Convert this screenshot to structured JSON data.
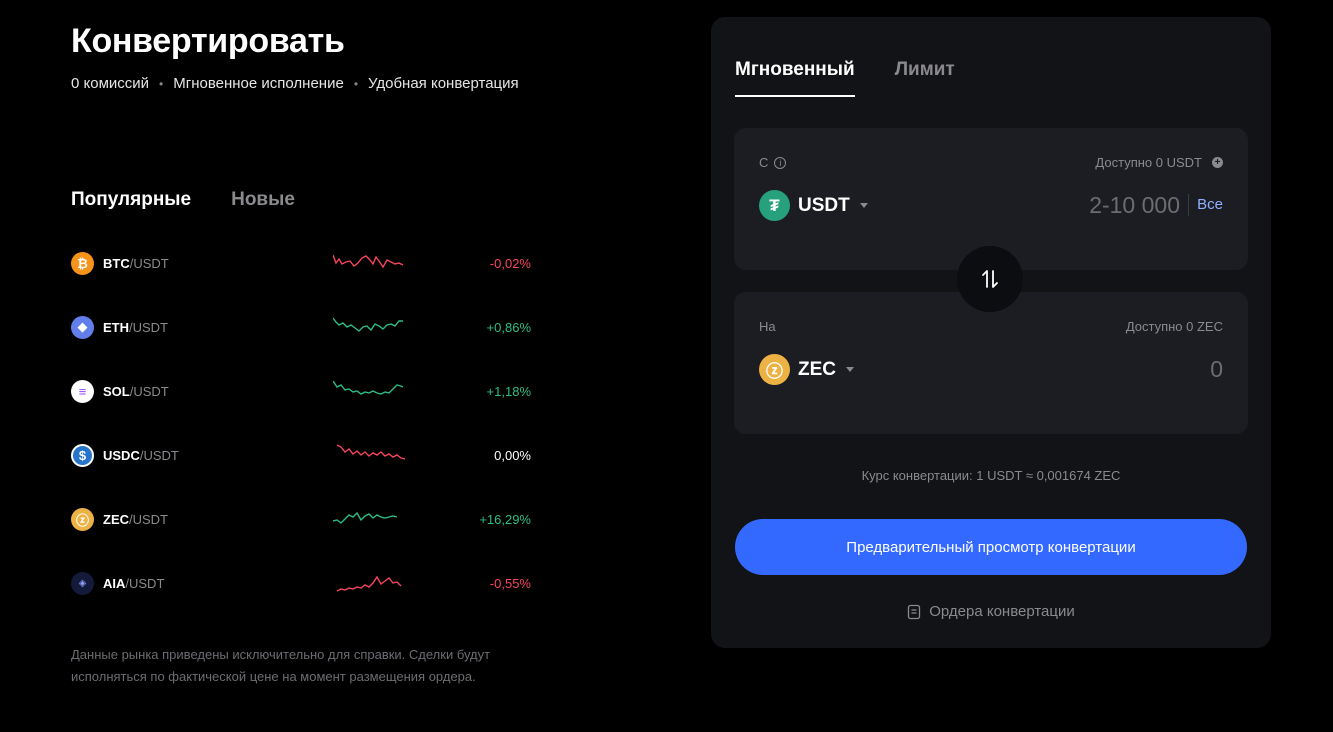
{
  "header": {
    "title": "Конвертировать",
    "features": [
      "0 комиссий",
      "Мгновенное исполнение",
      "Удобная конвертация"
    ]
  },
  "market": {
    "tabs": [
      "Популярные",
      "Новые"
    ],
    "pairs": [
      {
        "base": "BTC",
        "quote": "/USDT",
        "change": "-0,02%",
        "trend": "neg",
        "icon": "bitcoin-icon",
        "color": "#f7931a",
        "glyph": "₿"
      },
      {
        "base": "ETH",
        "quote": "/USDT",
        "change": "+0,86%",
        "trend": "pos",
        "icon": "ethereum-icon",
        "color": "#627eea",
        "glyph": "◆"
      },
      {
        "base": "SOL",
        "quote": "/USDT",
        "change": "+1,18%",
        "trend": "pos",
        "icon": "solana-icon",
        "color": "#ffffff",
        "glyph": "≡"
      },
      {
        "base": "USDC",
        "quote": "/USDT",
        "change": "0,00%",
        "trend": "neu",
        "icon": "usdc-icon",
        "color": "#2775ca",
        "glyph": "$"
      },
      {
        "base": "ZEC",
        "quote": "/USDT",
        "change": "+16,29%",
        "trend": "pos",
        "icon": "zcash-icon",
        "color": "#ecb244",
        "glyph": "ⓩ"
      },
      {
        "base": "AIA",
        "quote": "/USDT",
        "change": "-0,55%",
        "trend": "neg",
        "icon": "aia-icon",
        "color": "#141a3a",
        "glyph": "◈"
      }
    ],
    "disclaimer": "Данные рынка приведены исключительно для справки. Сделки будут исполняться по фактической цене на момент размещения ордера."
  },
  "converter": {
    "tabs": [
      "Мгновенный",
      "Лимит"
    ],
    "from": {
      "label": "С",
      "available": "Доступно 0 USDT",
      "coin": "USDT",
      "amount_placeholder": "2-10 000",
      "all_label": "Все"
    },
    "to": {
      "label": "На",
      "available": "Доступно 0 ZEC",
      "coin": "ZEC",
      "amount": "0"
    },
    "rate": "Курс конвертации: 1 USDT ≈ 0,001674 ZEC",
    "preview_label": "Предварительный просмотр конвертации",
    "orders_label": "Ордера конвертации"
  },
  "colors": {
    "accent": "#3369ff",
    "negative": "#f6465d",
    "positive": "#2ebd85",
    "usdt": "#26a17b",
    "zec": "#ecb244"
  }
}
